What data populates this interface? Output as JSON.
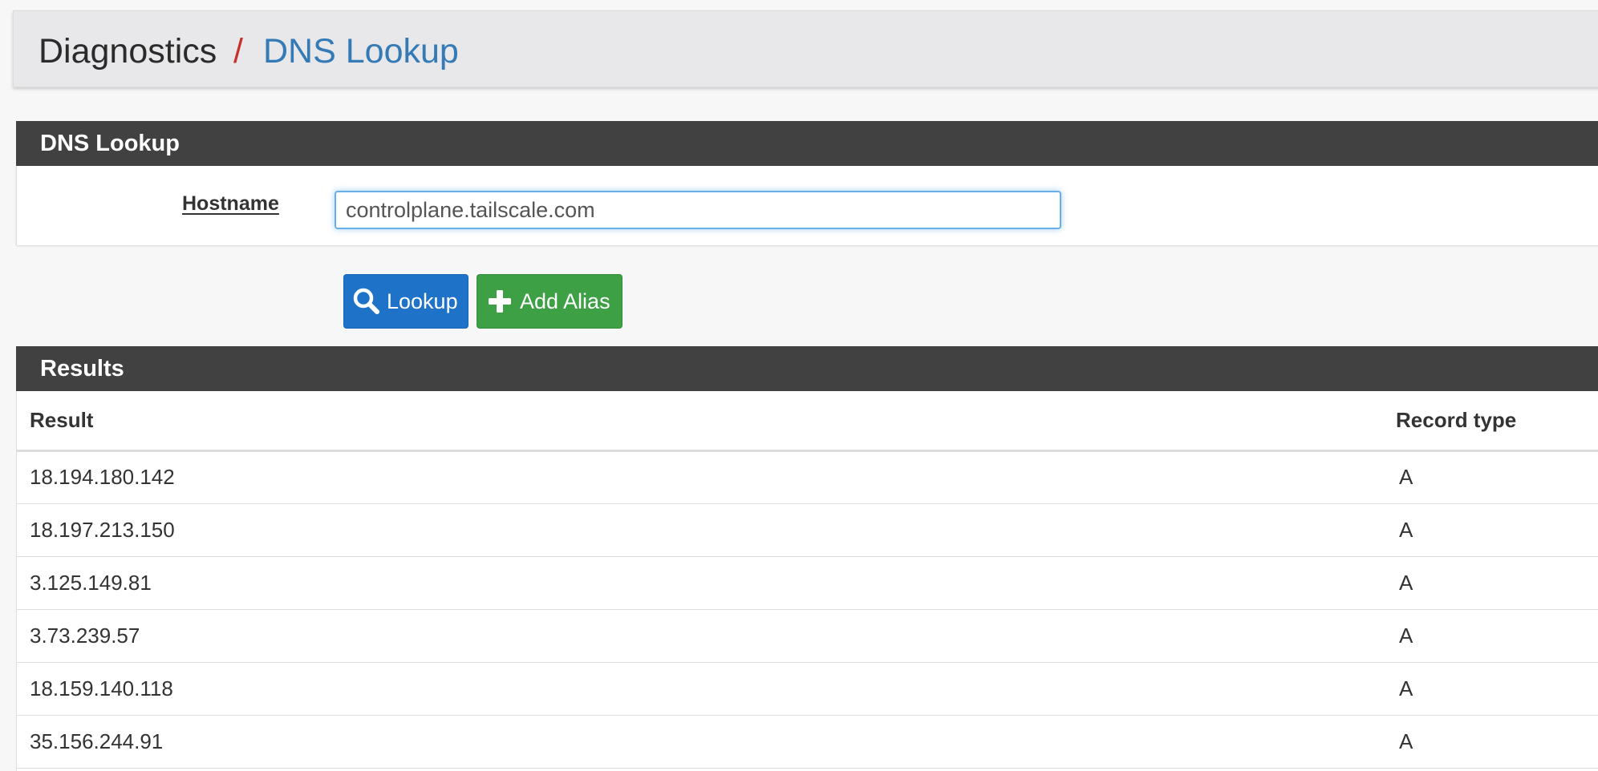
{
  "breadcrumb": {
    "parent": "Diagnostics",
    "separator": "/",
    "current": "DNS Lookup"
  },
  "lookup_panel": {
    "title": "DNS Lookup",
    "hostname_label": "Hostname",
    "hostname_value": "controlplane.tailscale.com"
  },
  "buttons": {
    "lookup_label": "Lookup",
    "lookup_icon": "search-icon",
    "add_alias_label": "Add Alias",
    "add_alias_icon": "plus-icon"
  },
  "results_panel": {
    "title": "Results",
    "columns": [
      "Result",
      "Record type"
    ],
    "rows": [
      {
        "result": "18.194.180.142",
        "type": "A"
      },
      {
        "result": "18.197.213.150",
        "type": "A"
      },
      {
        "result": "3.125.149.81",
        "type": "A"
      },
      {
        "result": "3.73.239.57",
        "type": "A"
      },
      {
        "result": "18.159.140.118",
        "type": "A"
      },
      {
        "result": "35.156.244.91",
        "type": "A"
      }
    ]
  },
  "colors": {
    "panel_heading": "#414141",
    "breadcrumb_link": "#337ab7",
    "separator": "#c9302c",
    "lookup_button": "#1e73c9",
    "add_alias_button": "#3ea045"
  }
}
